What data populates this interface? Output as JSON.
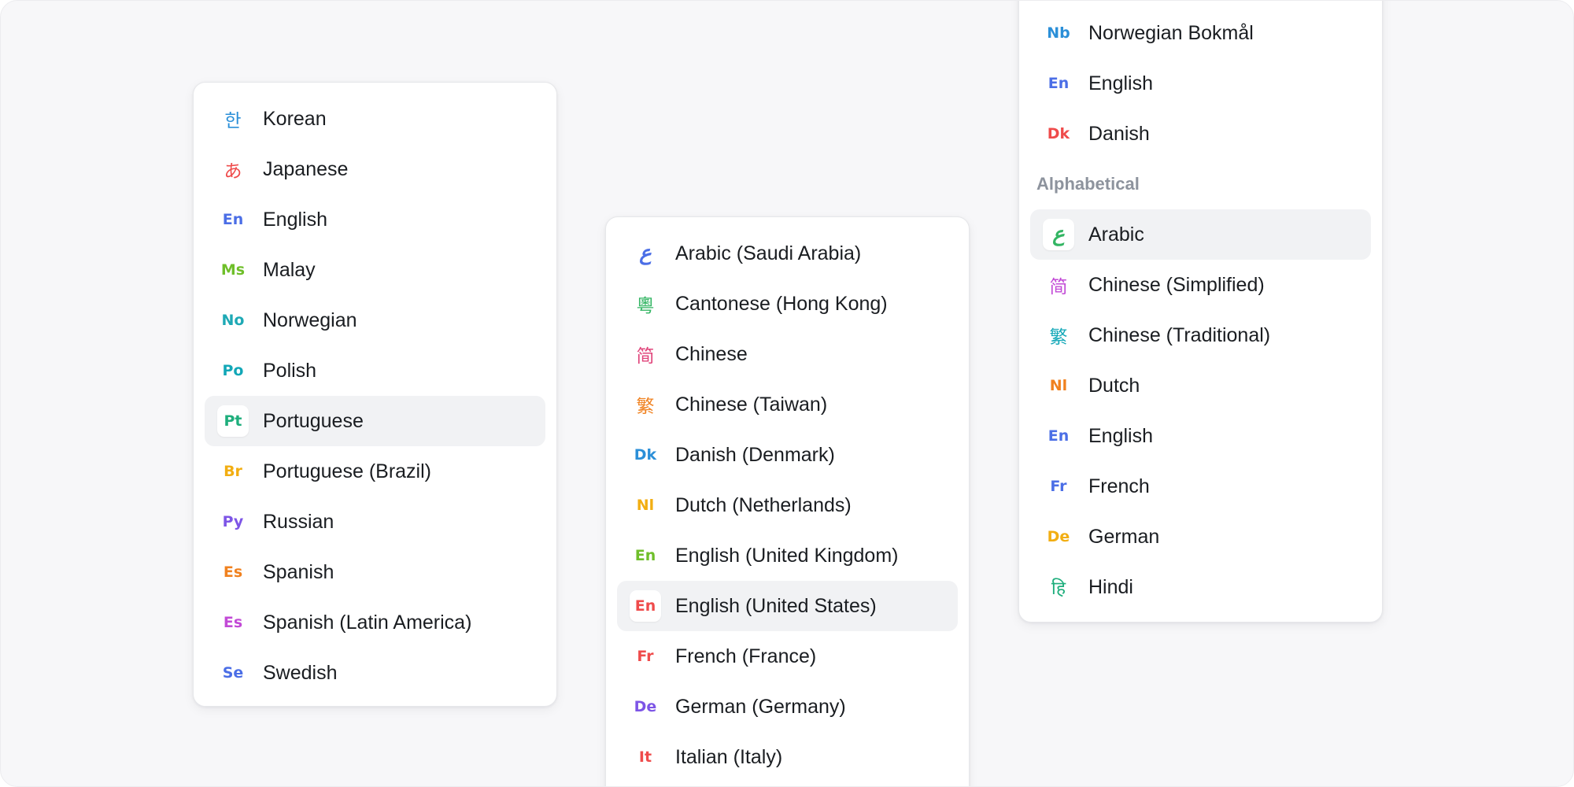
{
  "menus": [
    {
      "items": [
        {
          "label": "Korean",
          "icon": "한",
          "icon_name": "hangul-icon",
          "color": "#2b8fd8",
          "type": "cjk"
        },
        {
          "label": "Japanese",
          "icon": "あ",
          "icon_name": "hiragana-icon",
          "color": "#ef4b4b",
          "type": "cjk"
        },
        {
          "label": "English",
          "icon": "En",
          "icon_name": "en-code-icon",
          "color": "#4b6ee6"
        },
        {
          "label": "Malay",
          "icon": "Ms",
          "icon_name": "ms-code-icon",
          "color": "#6fbf2a"
        },
        {
          "label": "Norwegian",
          "icon": "No",
          "icon_name": "no-code-icon",
          "color": "#1ea9b5"
        },
        {
          "label": "Polish",
          "icon": "Po",
          "icon_name": "po-code-icon",
          "color": "#12a7b7"
        },
        {
          "label": "Portuguese",
          "icon": "Pt",
          "icon_name": "pt-code-icon",
          "color": "#1eae7c",
          "selected": true
        },
        {
          "label": "Portuguese (Brazil)",
          "icon": "Br",
          "icon_name": "br-code-icon",
          "color": "#f2ae12"
        },
        {
          "label": "Russian",
          "icon": "Py",
          "icon_name": "py-code-icon",
          "color": "#7d55e6"
        },
        {
          "label": "Spanish",
          "icon": "Es",
          "icon_name": "es-code-icon",
          "color": "#f0811f"
        },
        {
          "label": "Spanish (Latin America)",
          "icon": "Es",
          "icon_name": "es-code-icon",
          "color": "#c24ad6"
        },
        {
          "label": "Swedish",
          "icon": "Se",
          "icon_name": "se-code-icon",
          "color": "#4b6ee6"
        }
      ]
    },
    {
      "items": [
        {
          "label": "Arabic (Saudi Arabia)",
          "icon": "ع",
          "icon_name": "arabic-ain-icon",
          "color": "#4b6ee6",
          "type": "ar"
        },
        {
          "label": "Cantonese (Hong Kong)",
          "icon": "粵",
          "icon_name": "cantonese-char-icon",
          "color": "#33b563",
          "type": "cjk"
        },
        {
          "label": "Chinese",
          "icon": "简",
          "icon_name": "simplified-char-icon",
          "color": "#e0457b",
          "type": "cjk"
        },
        {
          "label": "Chinese (Taiwan)",
          "icon": "繁",
          "icon_name": "traditional-char-icon",
          "color": "#f0811f",
          "type": "cjk"
        },
        {
          "label": "Danish (Denmark)",
          "icon": "Dk",
          "icon_name": "dk-code-icon",
          "color": "#2b8fd8"
        },
        {
          "label": "Dutch (Netherlands)",
          "icon": "Nl",
          "icon_name": "nl-code-icon",
          "color": "#f2ae12"
        },
        {
          "label": "English (United Kingdom)",
          "icon": "En",
          "icon_name": "en-code-icon",
          "color": "#6fbf2a"
        },
        {
          "label": "English (United States)",
          "icon": "En",
          "icon_name": "en-code-icon",
          "color": "#ef4b4b",
          "selected": true
        },
        {
          "label": "French (France)",
          "icon": "Fr",
          "icon_name": "fr-code-icon",
          "color": "#ef4b4b"
        },
        {
          "label": "German (Germany)",
          "icon": "De",
          "icon_name": "de-code-icon",
          "color": "#7d55e6"
        },
        {
          "label": "Italian (Italy)",
          "icon": "It",
          "icon_name": "it-code-icon",
          "color": "#ef4b4b"
        }
      ]
    },
    {
      "groups": [
        {
          "header": "",
          "items": [
            {
              "label": "Norwegian Bokmål",
              "icon": "Nb",
              "icon_name": "nb-code-icon",
              "color": "#2b8fd8"
            },
            {
              "label": "English",
              "icon": "En",
              "icon_name": "en-code-icon",
              "color": "#4b6ee6"
            },
            {
              "label": "Danish",
              "icon": "Dk",
              "icon_name": "dk-code-icon",
              "color": "#ef4b4b"
            }
          ]
        },
        {
          "header": "Alphabetical",
          "items": [
            {
              "label": "Arabic",
              "icon": "ع",
              "icon_name": "arabic-ain-icon",
              "color": "#33b563",
              "type": "ar",
              "selected": true
            },
            {
              "label": "Chinese (Simplified)",
              "icon": "简",
              "icon_name": "simplified-char-icon",
              "color": "#c24ad6",
              "type": "cjk"
            },
            {
              "label": "Chinese (Traditional)",
              "icon": "繁",
              "icon_name": "traditional-char-icon",
              "color": "#12a7b7",
              "type": "cjk"
            },
            {
              "label": "Dutch",
              "icon": "Nl",
              "icon_name": "nl-code-icon",
              "color": "#f0811f"
            },
            {
              "label": "English",
              "icon": "En",
              "icon_name": "en-code-icon",
              "color": "#4b6ee6"
            },
            {
              "label": "French",
              "icon": "Fr",
              "icon_name": "fr-code-icon",
              "color": "#4b6ee6"
            },
            {
              "label": "German",
              "icon": "De",
              "icon_name": "de-code-icon",
              "color": "#f2ae12"
            },
            {
              "label": "Hindi",
              "icon": "हि",
              "icon_name": "devanagari-hi-icon",
              "color": "#1eae7c",
              "type": "cjk"
            }
          ]
        }
      ]
    }
  ]
}
